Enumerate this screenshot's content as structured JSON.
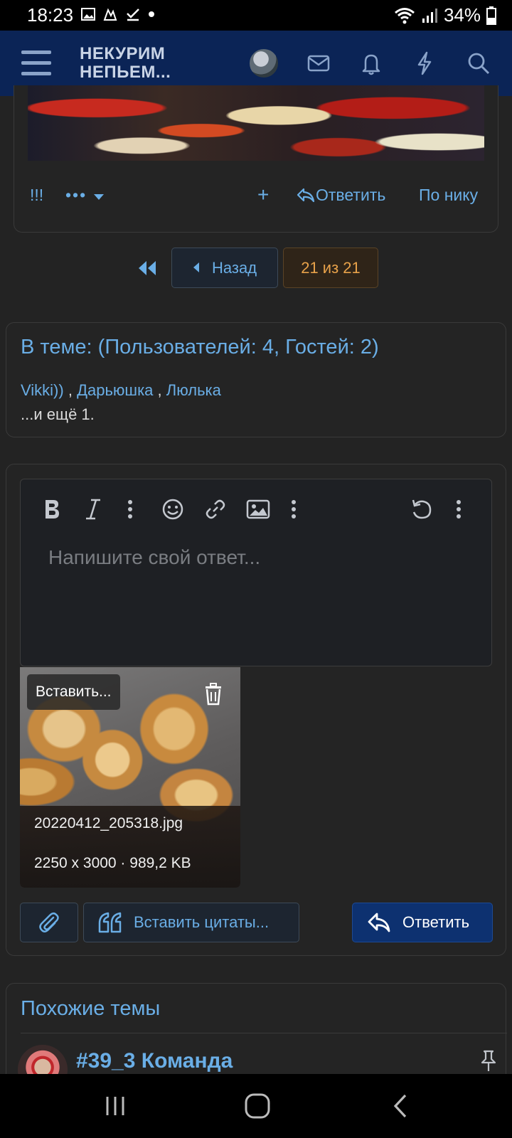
{
  "status_bar": {
    "time": "18:23",
    "battery": "34%"
  },
  "header": {
    "logo_line1": "НЕКУРИМ",
    "logo_line2": "НЕПЬЕМ..."
  },
  "post_actions": {
    "important": "!!!",
    "more": "•••",
    "add": "+",
    "reply": "Ответить",
    "by_nick": "По нику"
  },
  "pagination": {
    "prev": "Назад",
    "current": "21 из 21"
  },
  "online": {
    "title": "В теме: (Пользователей: 4, Гостей: 2)",
    "users": [
      "Vikki))",
      "Дарьюшка",
      "Люлька"
    ],
    "sep": ",",
    "more": "...и ещё 1."
  },
  "editor": {
    "placeholder": "Напишите свой ответ...",
    "attachment": {
      "insert_label": "Вставить...",
      "filename": "20220412_205318.jpg",
      "meta": "2250 x 3000 · 989,2 KB"
    },
    "quote_label": "Вставить цитаты...",
    "reply_label": "Ответить"
  },
  "similar": {
    "title": "Похожие темы",
    "topic_title": "#39_3 Команда"
  },
  "colors": {
    "accent": "#6aaee6",
    "header_bg": "#0b2456",
    "page_bg": "#232323",
    "current_page": "#e8a24a"
  }
}
